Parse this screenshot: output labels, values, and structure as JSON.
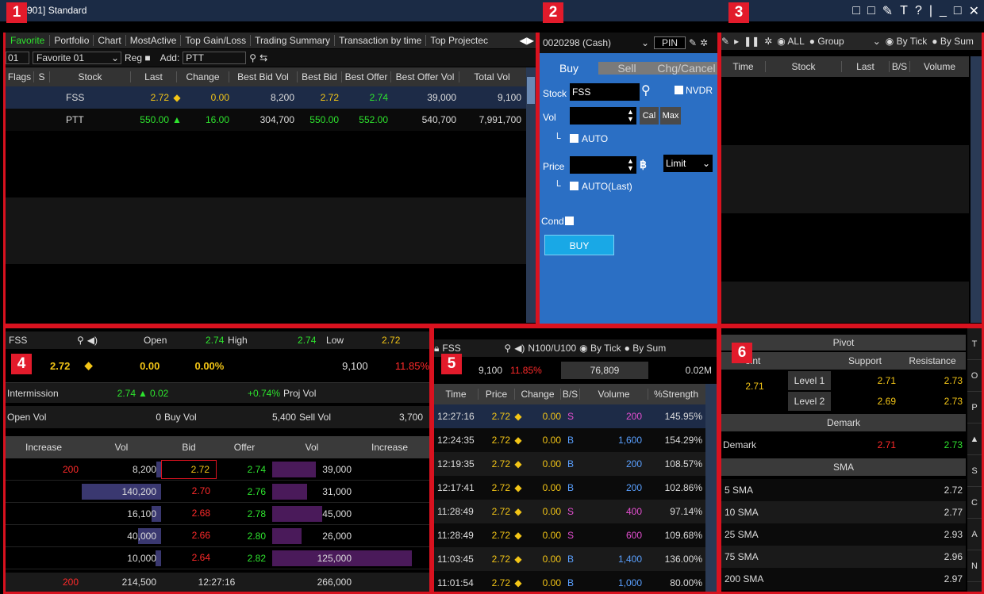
{
  "window": {
    "title": "901] Standard"
  },
  "badges": [
    "1",
    "2",
    "3",
    "4",
    "5",
    "6"
  ],
  "p1": {
    "tabs": [
      "Favorite",
      "Portfolio",
      "Chart",
      "MostActive",
      "Top Gain/Loss",
      "Trading Summary",
      "Transaction by time",
      "Top Projectec"
    ],
    "fav_num": "01",
    "fav_name": "Favorite 01",
    "reg": "Reg",
    "add_label": "Add:",
    "add_value": "PTT",
    "cols": [
      "Flags",
      "S",
      "Stock",
      "Last",
      "Change",
      "Best Bid Vol",
      "Best Bid",
      "Best Offer",
      "Best Offer Vol",
      "Total Vol"
    ],
    "rows": [
      {
        "stock": "FSS",
        "last": "2.72",
        "arrow": "◆",
        "change": "0.00",
        "bbv": "8,200",
        "bb": "2.72",
        "bo": "2.74",
        "bov": "39,000",
        "tv": "9,100"
      },
      {
        "stock": "PTT",
        "last": "550.00",
        "arrow": "▲",
        "change": "16.00",
        "bbv": "304,700",
        "bb": "550.00",
        "bo": "552.00",
        "bov": "540,700",
        "tv": "7,991,700"
      }
    ]
  },
  "p2": {
    "account": "0020298 (Cash)",
    "pin": "PIN",
    "tabs": [
      "Buy",
      "Sell",
      "Chg/Cancel"
    ],
    "stock_label": "Stock",
    "stock_value": "FSS",
    "nvdr": "NVDR",
    "vol_label": "Vol",
    "cal": "Cal",
    "max": "Max",
    "auto": "AUTO",
    "price_label": "Price",
    "baht": "฿",
    "limit": "Limit",
    "auto_last": "AUTO(Last)",
    "cond": "Cond",
    "buy_btn": "BUY"
  },
  "p3": {
    "all": "ALL",
    "group": "Group",
    "by_tick": "By Tick",
    "by_sum": "By Sum",
    "cols": [
      "Time",
      "Stock",
      "Last",
      "B/S",
      "Volume"
    ],
    "icons": [
      "□",
      "□",
      "✎",
      "T",
      "?",
      "|",
      "_",
      "□",
      "✕"
    ]
  },
  "p4": {
    "symbol": "FSS",
    "open_label": "Open",
    "open": "2.74",
    "high_label": "High",
    "high": "2.74",
    "low_label": "Low",
    "low": "2.72",
    "last": "2.72",
    "change": "0.00",
    "pct": "0.00%",
    "vol": "9,100",
    "pct2": "11.85%",
    "interm_label": "Intermission",
    "interm": "2.74",
    "interm_chg": "0.02",
    "interm_pct": "+0.74%",
    "projvol_label": "Proj Vol",
    "openvol_label": "Open Vol",
    "openvol": "0",
    "buyvol_label": "Buy Vol",
    "buyvol": "5,400",
    "sellvol_label": "Sell Vol",
    "sellvol": "3,700",
    "cols": [
      "Increase",
      "Vol",
      "Bid",
      "Offer",
      "Vol",
      "Increase"
    ],
    "rows": [
      {
        "inc": "200",
        "vol": "8,200",
        "bid": "2.72",
        "offer": "2.74",
        "ovol": "39,000",
        "bw": 0.06,
        "ow": 0.31
      },
      {
        "inc": "",
        "vol": "140,200",
        "bid": "2.70",
        "offer": "2.76",
        "ovol": "31,000",
        "bw": 1.0,
        "ow": 0.25
      },
      {
        "inc": "",
        "vol": "16,100",
        "bid": "2.68",
        "offer": "2.78",
        "ovol": "45,000",
        "bw": 0.12,
        "ow": 0.36
      },
      {
        "inc": "",
        "vol": "40,000",
        "bid": "2.66",
        "offer": "2.80",
        "ovol": "26,000",
        "bw": 0.29,
        "ow": 0.21
      },
      {
        "inc": "",
        "vol": "10,000",
        "bid": "2.64",
        "offer": "2.82",
        "ovol": "125,000",
        "bw": 0.07,
        "ow": 1.0
      }
    ],
    "footer_inc": "200",
    "footer_vol": "214,500",
    "footer_time": "12:27:16",
    "footer_ovol": "266,000"
  },
  "p5": {
    "symbol": "FSS",
    "nu": "N100/U100",
    "by_tick": "By Tick",
    "by_sum": "By Sum",
    "vol": "9,100",
    "pct": "11.85%",
    "mid": "76,809",
    "val": "0.02M",
    "cols": [
      "Time",
      "Price",
      "Change",
      "B/S",
      "Volume",
      "%Strength"
    ],
    "rows": [
      {
        "time": "12:27:16",
        "price": "2.72",
        "chg": "0.00",
        "bs": "S",
        "vol": "200",
        "str": "145.95%"
      },
      {
        "time": "12:24:35",
        "price": "2.72",
        "chg": "0.00",
        "bs": "B",
        "vol": "1,600",
        "str": "154.29%"
      },
      {
        "time": "12:19:35",
        "price": "2.72",
        "chg": "0.00",
        "bs": "B",
        "vol": "200",
        "str": "108.57%"
      },
      {
        "time": "12:17:41",
        "price": "2.72",
        "chg": "0.00",
        "bs": "B",
        "vol": "200",
        "str": "102.86%"
      },
      {
        "time": "11:28:49",
        "price": "2.72",
        "chg": "0.00",
        "bs": "S",
        "vol": "400",
        "str": "97.14%"
      },
      {
        "time": "11:28:49",
        "price": "2.72",
        "chg": "0.00",
        "bs": "S",
        "vol": "600",
        "str": "109.68%"
      },
      {
        "time": "11:03:45",
        "price": "2.72",
        "chg": "0.00",
        "bs": "B",
        "vol": "1,400",
        "str": "136.00%"
      },
      {
        "time": "11:01:54",
        "price": "2.72",
        "chg": "0.00",
        "bs": "B",
        "vol": "1,000",
        "str": "80.00%"
      }
    ]
  },
  "p6": {
    "pivot": "Pivot",
    "point": "oint",
    "support": "Support",
    "resistance": "Resistance",
    "pivot_val": "2.71",
    "lv1": "Level 1",
    "lv1_s": "2.71",
    "lv1_r": "2.73",
    "lv2": "Level 2",
    "lv2_s": "2.69",
    "lv2_r": "2.73",
    "demark_h": "Demark",
    "demark": "Demark",
    "demark_s": "2.71",
    "demark_r": "2.73",
    "sma_h": "SMA",
    "sma": [
      {
        "label": "5 SMA",
        "val": "2.72"
      },
      {
        "label": "10 SMA",
        "val": "2.77"
      },
      {
        "label": "25 SMA",
        "val": "2.93"
      },
      {
        "label": "75 SMA",
        "val": "2.96"
      },
      {
        "label": "200 SMA",
        "val": "2.97"
      }
    ],
    "side": [
      "T",
      "O",
      "P",
      "▲",
      "S",
      "C",
      "A",
      "N"
    ]
  }
}
